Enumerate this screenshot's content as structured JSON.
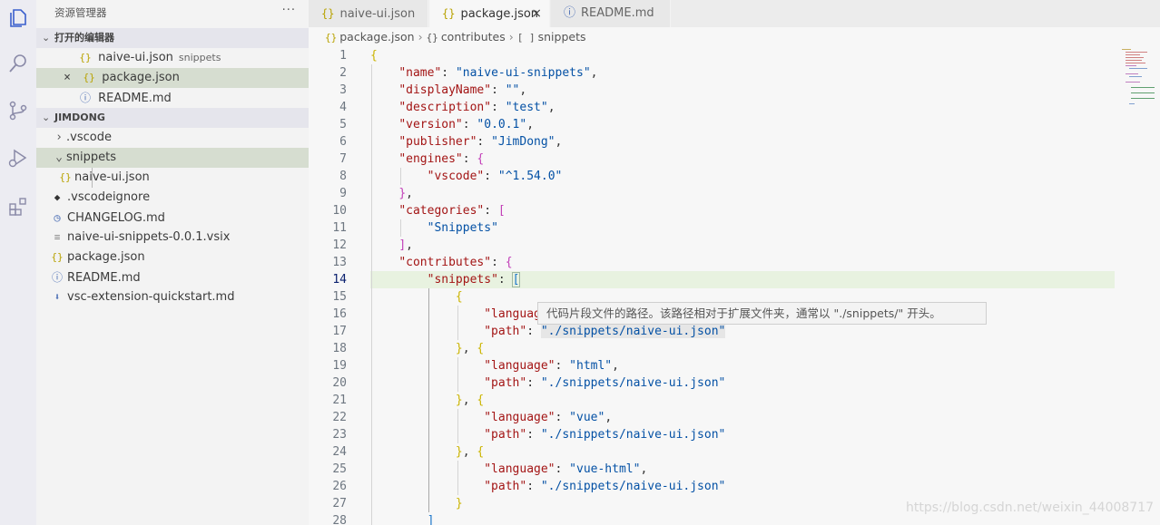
{
  "sidebar": {
    "title": "资源管理器",
    "more": "···",
    "open_editors": {
      "header": "打开的编辑器",
      "items": [
        {
          "label": "naive-ui.json",
          "hint": "snippets",
          "icon": "{}"
        },
        {
          "label": "package.json",
          "hint": "",
          "icon": "{}"
        },
        {
          "label": "README.md",
          "hint": "",
          "icon": "ⓘ"
        }
      ]
    },
    "workspace": {
      "header": "JIMDONG",
      "items": [
        {
          "label": ".vscode",
          "icon": "›"
        },
        {
          "label": "snippets",
          "icon": "⌄"
        },
        {
          "label": "naive-ui.json",
          "icon": "{}"
        },
        {
          "label": ".vscodeignore",
          "icon": "◆"
        },
        {
          "label": "CHANGELOG.md",
          "icon": "◷"
        },
        {
          "label": "naive-ui-snippets-0.0.1.vsix",
          "icon": "≡"
        },
        {
          "label": "package.json",
          "icon": "{}"
        },
        {
          "label": "README.md",
          "icon": "ⓘ"
        },
        {
          "label": "vsc-extension-quickstart.md",
          "icon": "⬇"
        }
      ]
    }
  },
  "tabs": [
    {
      "label": "naive-ui.json",
      "icon": "{}"
    },
    {
      "label": "package.json",
      "icon": "{}",
      "close": "×"
    },
    {
      "label": "README.md",
      "icon": "ⓘ"
    }
  ],
  "breadcrumb": {
    "file": "package.json",
    "item2": "contributes",
    "item2_icon": "{}",
    "item3": "snippets",
    "item3_icon": "[ ]",
    "separator": "›"
  },
  "tooltip": "代码片段文件的路径。该路径相对于扩展文件夹，通常以 \"./snippets/\" 开头。",
  "watermark": "https://blog.csdn.net/weixin_44008717",
  "code": {
    "current_line": 14,
    "lines": [
      "1",
      "2",
      "3",
      "4",
      "5",
      "6",
      "7",
      "8",
      "9",
      "10",
      "11",
      "12",
      "13",
      "14",
      "15",
      "16",
      "17",
      "18",
      "19",
      "20",
      "21",
      "22",
      "23",
      "24",
      "25",
      "26",
      "27",
      "28"
    ],
    "t": {
      "name_k": "\"name\"",
      "name_v": "\"naive-ui-snippets\"",
      "display_k": "\"displayName\"",
      "display_v": "\"\"",
      "desc_k": "\"description\"",
      "desc_v": "\"test\"",
      "ver_k": "\"version\"",
      "ver_v": "\"0.0.1\"",
      "pub_k": "\"publisher\"",
      "pub_v": "\"JimDong\"",
      "eng_k": "\"engines\"",
      "vscode_k": "\"vscode\"",
      "vscode_v": "\"^1.54.0\"",
      "cat_k": "\"categories\"",
      "cat_v": "\"Snippets\"",
      "contrib_k": "\"contributes\"",
      "snip_k": "\"snippets\"",
      "lang_k": "\"language\"",
      "path_k": "\"path\"",
      "path_v": "\"./snippets/naive-ui.json\"",
      "lang_html": "\"html\"",
      "lang_vue": "\"vue\"",
      "lang_vuehtml": "\"vue-html\""
    }
  },
  "colors": {
    "accent_selection": "#d6ddd0",
    "current_line": "#e8f2e0",
    "keyword": "#a31515",
    "string": "#0451a5"
  }
}
